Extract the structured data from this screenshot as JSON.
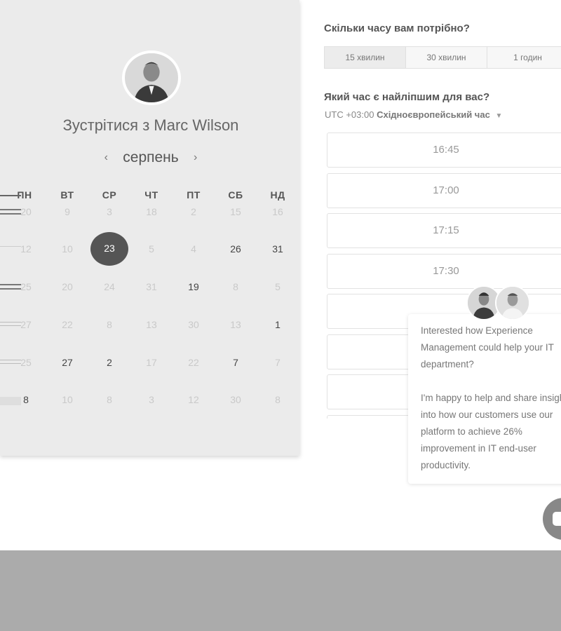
{
  "host": {
    "meet_title": "Зустрітися з Marc Wilson",
    "avatar_icon": "host-avatar"
  },
  "calendar": {
    "month": "серпень",
    "prev_icon": "chevron-left-icon",
    "next_icon": "chevron-right-icon",
    "prev_glyph": "‹",
    "next_glyph": "›",
    "day_headers": [
      "ПН",
      "ВТ",
      "СР",
      "ЧТ",
      "ПТ",
      "СБ",
      "НД"
    ],
    "rows": [
      [
        "20",
        "9",
        "3",
        "18",
        "2",
        "15",
        "16"
      ],
      [
        "12",
        "10",
        "23",
        "5",
        "4",
        "26",
        "31"
      ],
      [
        "25",
        "20",
        "24",
        "31",
        "19",
        "8",
        "5"
      ],
      [
        "27",
        "22",
        "8",
        "13",
        "30",
        "13",
        "1"
      ],
      [
        "25",
        "27",
        "2",
        "17",
        "22",
        "7",
        "7"
      ],
      [
        "8",
        "10",
        "8",
        "3",
        "12",
        "30",
        "8"
      ]
    ],
    "available": [
      [
        1,
        5
      ],
      [
        1,
        6
      ],
      [
        2,
        4
      ],
      [
        3,
        6
      ],
      [
        4,
        1
      ],
      [
        4,
        2
      ],
      [
        4,
        5
      ],
      [
        5,
        0
      ]
    ],
    "selected": [
      1,
      2
    ]
  },
  "scheduler": {
    "duration_question": "Скільки часу вам потрібно?",
    "durations": [
      "15 хвилин",
      "30 хвилин",
      "1 годин"
    ],
    "active_duration": 0,
    "time_question": "Який час є найліпшим для вас?",
    "timezone_prefix": "UTC +03:00",
    "timezone_name": "Східноєвропейський час",
    "slots": [
      "16:45",
      "17:00",
      "17:15",
      "17:30",
      "",
      "",
      "",
      ""
    ]
  },
  "chat": {
    "message": "Interested how Experience Management could help your IT department?\n\nI'm happy to help and share insight into how our customers use our platform to achieve 26% improvement in IT end-user productivity."
  }
}
